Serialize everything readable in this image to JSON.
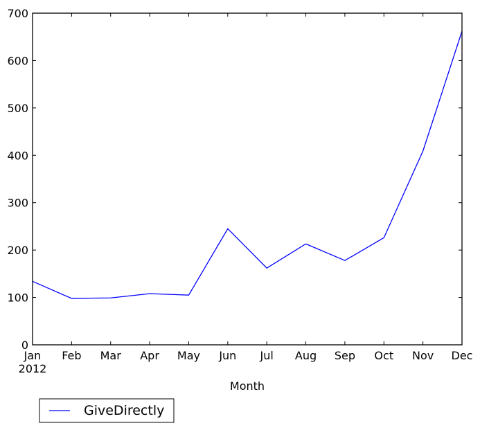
{
  "chart_data": {
    "type": "line",
    "title": "",
    "xlabel": "Month",
    "ylabel": "",
    "categories": [
      "Jan",
      "Feb",
      "Mar",
      "Apr",
      "May",
      "Jun",
      "Jul",
      "Aug",
      "Sep",
      "Oct",
      "Nov",
      "Dec"
    ],
    "x_year_label": "2012",
    "ylim": [
      0,
      700
    ],
    "yticks": [
      0,
      100,
      200,
      300,
      400,
      500,
      600,
      700
    ],
    "grid": false,
    "legend_position": "below-left",
    "series": [
      {
        "name": "GiveDirectly",
        "color": "#0000ff",
        "values": [
          134,
          98,
          99,
          108,
          105,
          245,
          162,
          213,
          178,
          226,
          409,
          662
        ]
      }
    ]
  }
}
